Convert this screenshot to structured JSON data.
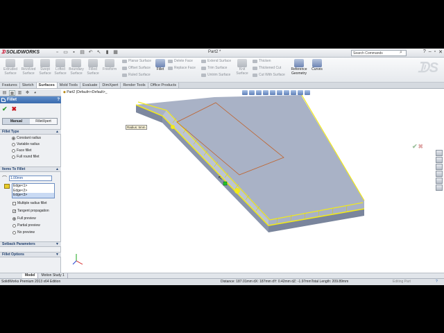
{
  "app": {
    "brand": "SOLIDWORKS",
    "doc_title": "Part2 *",
    "search_placeholder": "Search Commands"
  },
  "ribbon": {
    "large_buttons": [
      {
        "label": "Extruded\nSurface",
        "icon": "extruded-surface-icon",
        "active": false
      },
      {
        "label": "Revolved\nSurface",
        "icon": "revolved-surface-icon",
        "active": false
      },
      {
        "label": "Swept\nSurface",
        "icon": "swept-surface-icon",
        "active": false
      },
      {
        "label": "Lofted\nSurface",
        "icon": "lofted-surface-icon",
        "active": false
      },
      {
        "label": "Boundary\nSurface",
        "icon": "boundary-surface-icon",
        "active": false
      },
      {
        "label": "Filled\nSurface",
        "icon": "filled-surface-icon",
        "active": false
      },
      {
        "label": "Freeform",
        "icon": "freeform-icon",
        "active": false
      },
      {
        "label": "Fillet",
        "icon": "fillet-icon",
        "active": true
      },
      {
        "label": "Knit\nSurface",
        "icon": "knit-surface-icon",
        "active": false
      },
      {
        "label": "Reference\nGeometry",
        "icon": "reference-geometry-icon",
        "active": true
      },
      {
        "label": "Curves",
        "icon": "curves-icon",
        "active": true
      }
    ],
    "small_buttons": {
      "planar": "Planar Surface",
      "offset": "Offset Surface",
      "ruled": "Ruled Surface",
      "delete_face": "Delete Face",
      "replace_face": "Replace Face",
      "extend": "Extend Surface",
      "trim": "Trim Surface",
      "untrim": "Untrim Surface",
      "thicken": "Thicken",
      "thickened_cut": "Thickened Cut",
      "cut_with_surface": "Cut With Surface"
    }
  },
  "tabs": [
    "Features",
    "Sketch",
    "Surfaces",
    "Mold Tools",
    "Evaluate",
    "DimXpert",
    "Render Tools",
    "Office Products"
  ],
  "active_tab": "Surfaces",
  "panel": {
    "title": "Fillet",
    "help": "?",
    "mode_manual": "Manual",
    "mode_xpert": "FilletXpert",
    "fillet_type": {
      "header": "Fillet Type",
      "options": [
        "Constant radius",
        "Variable radius",
        "Face fillet",
        "Full round fillet"
      ],
      "selected": "Constant radius"
    },
    "items": {
      "header": "Items To Fillet",
      "radius": "1.00mm",
      "edges": [
        "Edge<1>",
        "Edge<2>",
        "Edge<3>"
      ],
      "multiple_radius": "Multiple radius fillet",
      "tangent_propagation": "Tangent propagation",
      "preview_options": [
        "Full preview",
        "Partial preview",
        "No preview"
      ],
      "preview_selected": "Full preview"
    },
    "setback_header": "Setback Parameters",
    "options_header": "Fillet Options"
  },
  "viewport": {
    "tree_root": "Part2  (Default<<Default>_",
    "radius_callout": "Radius: 5mm"
  },
  "bottom_tabs": [
    "Model",
    "Motion Study 1"
  ],
  "status": {
    "edition": "SolidWorks Premium 2013 x64 Edition",
    "measure": "Distance: 187.01mm    dX: 187mm    dY: 0.42mm    dZ: -1.97mmTotal Length: 209.89mm",
    "editing": "Editing Part",
    "help_icon": "?"
  },
  "colors": {
    "selection": "#f2ea1a",
    "model_face": "#a9b2c6",
    "accent": "#3a6aad"
  }
}
